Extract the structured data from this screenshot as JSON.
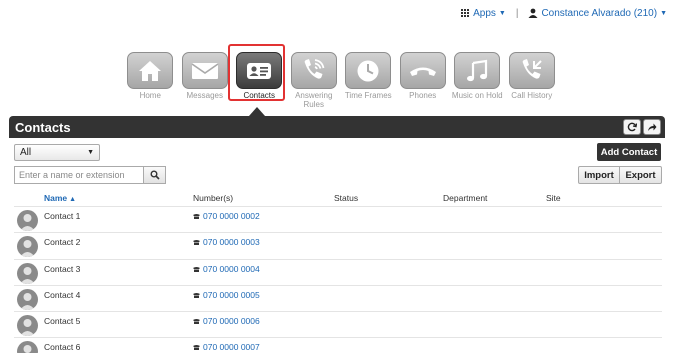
{
  "topbar": {
    "apps_label": "Apps",
    "user_label": "Constance Alvarado (210)"
  },
  "nav": {
    "items": [
      {
        "label": "Home",
        "icon": "home-icon"
      },
      {
        "label": "Messages",
        "icon": "envelope-icon"
      },
      {
        "label": "Contacts",
        "icon": "contact-card-icon",
        "active": true
      },
      {
        "label": "Answering Rules",
        "icon": "call-forward-icon"
      },
      {
        "label": "Time Frames",
        "icon": "clock-icon"
      },
      {
        "label": "Phones",
        "icon": "handset-icon"
      },
      {
        "label": "Music on Hold",
        "icon": "music-note-icon"
      },
      {
        "label": "Call History",
        "icon": "call-history-icon"
      }
    ]
  },
  "header": {
    "title": "Contacts",
    "refresh_icon": "refresh-icon",
    "export_icon": "share-arrow-icon"
  },
  "filter": {
    "selected": "All"
  },
  "add_contact_label": "Add Contact",
  "search": {
    "placeholder": "Enter a name or extension"
  },
  "import_label": "Import",
  "export_label": "Export",
  "table": {
    "columns": [
      "Name",
      "Number(s)",
      "Status",
      "Department",
      "Site"
    ],
    "rows": [
      {
        "name": "Contact 1",
        "number": "070 0000 0002"
      },
      {
        "name": "Contact 2",
        "number": "070 0000 0003"
      },
      {
        "name": "Contact 3",
        "number": "070 0000 0004"
      },
      {
        "name": "Contact 4",
        "number": "070 0000 0005"
      },
      {
        "name": "Contact 5",
        "number": "070 0000 0006"
      },
      {
        "name": "Contact 6",
        "number": "070 0000 0007"
      }
    ]
  },
  "colors": {
    "link": "#1f69b5",
    "header_bg": "#333333",
    "active_highlight": "#e23232"
  }
}
